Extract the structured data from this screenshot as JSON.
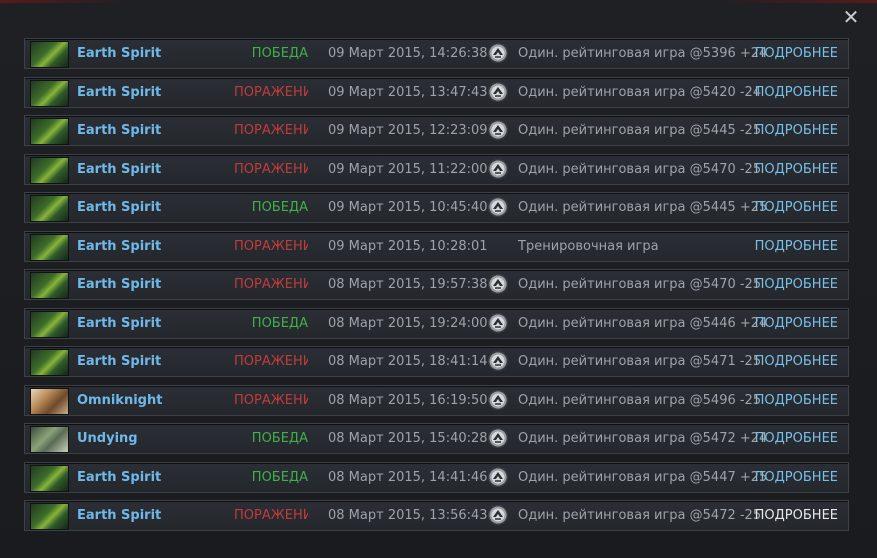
{
  "window": {
    "close_label": "✕"
  },
  "matches": [
    {
      "hero": "Earth Spirit",
      "hero_icon": "earth-spirit",
      "result": "ПОБЕДА",
      "outcome": "win",
      "date": "09 Март 2015, 14:26:38",
      "mode": "Один. рейтинговая игра @5396 +24",
      "mode_icon": "ranked-icon",
      "details": "ПОДРОБНЕЕ"
    },
    {
      "hero": "Earth Spirit",
      "hero_icon": "earth-spirit",
      "result": "ПОРАЖЕНИ",
      "outcome": "loss",
      "date": "09 Март 2015, 13:47:43",
      "mode": "Один. рейтинговая игра @5420 -24",
      "mode_icon": "ranked-icon",
      "details": "ПОДРОБНЕЕ"
    },
    {
      "hero": "Earth Spirit",
      "hero_icon": "earth-spirit",
      "result": "ПОРАЖЕНИ",
      "outcome": "loss",
      "date": "09 Март 2015, 12:23:09",
      "mode": "Один. рейтинговая игра @5445 -25",
      "mode_icon": "ranked-icon",
      "details": "ПОДРОБНЕЕ"
    },
    {
      "hero": "Earth Spirit",
      "hero_icon": "earth-spirit",
      "result": "ПОРАЖЕНИ",
      "outcome": "loss",
      "date": "09 Март 2015, 11:22:00",
      "mode": "Один. рейтинговая игра @5470 -25",
      "mode_icon": "ranked-icon",
      "details": "ПОДРОБНЕЕ"
    },
    {
      "hero": "Earth Spirit",
      "hero_icon": "earth-spirit",
      "result": "ПОБЕДА",
      "outcome": "win",
      "date": "09 Март 2015, 10:45:40",
      "mode": "Один. рейтинговая игра @5445 +25",
      "mode_icon": "ranked-icon",
      "details": "ПОДРОБНЕЕ"
    },
    {
      "hero": "Earth Spirit",
      "hero_icon": "earth-spirit",
      "result": "ПОРАЖЕНИ",
      "outcome": "loss",
      "date": "09 Март 2015, 10:28:01",
      "mode": "Тренировочная игра",
      "mode_icon": "",
      "details": "ПОДРОБНЕЕ"
    },
    {
      "hero": "Earth Spirit",
      "hero_icon": "earth-spirit",
      "result": "ПОРАЖЕНИ",
      "outcome": "loss",
      "date": "08 Март 2015, 19:57:38",
      "mode": "Один. рейтинговая игра @5470 -25",
      "mode_icon": "ranked-icon",
      "details": "ПОДРОБНЕЕ"
    },
    {
      "hero": "Earth Spirit",
      "hero_icon": "earth-spirit",
      "result": "ПОБЕДА",
      "outcome": "win",
      "date": "08 Март 2015, 19:24:00",
      "mode": "Один. рейтинговая игра @5446 +24",
      "mode_icon": "ranked-icon",
      "details": "ПОДРОБНЕЕ"
    },
    {
      "hero": "Earth Spirit",
      "hero_icon": "earth-spirit",
      "result": "ПОРАЖЕНИ",
      "outcome": "loss",
      "date": "08 Март 2015, 18:41:14",
      "mode": "Один. рейтинговая игра @5471 -25",
      "mode_icon": "ranked-icon",
      "details": "ПОДРОБНЕЕ"
    },
    {
      "hero": "Omniknight",
      "hero_icon": "omniknight",
      "result": "ПОРАЖЕНИ",
      "outcome": "loss",
      "date": "08 Март 2015, 16:19:50",
      "mode": "Один. рейтинговая игра @5496 -25",
      "mode_icon": "ranked-icon",
      "details": "ПОДРОБНЕЕ"
    },
    {
      "hero": "Undying",
      "hero_icon": "undying",
      "result": "ПОБЕДА",
      "outcome": "win",
      "date": "08 Март 2015, 15:40:28",
      "mode": "Один. рейтинговая игра @5472 +24",
      "mode_icon": "ranked-icon",
      "details": "ПОДРОБНЕЕ"
    },
    {
      "hero": "Earth Spirit",
      "hero_icon": "earth-spirit",
      "result": "ПОБЕДА",
      "outcome": "win",
      "date": "08 Март 2015, 14:41:46",
      "mode": "Один. рейтинговая игра @5447 +25",
      "mode_icon": "ranked-icon",
      "details": "ПОДРОБНЕЕ"
    },
    {
      "hero": "Earth Spirit",
      "hero_icon": "earth-spirit",
      "result": "ПОРАЖЕНИ",
      "outcome": "loss",
      "date": "08 Март 2015, 13:56:43",
      "mode": "Один. рейтинговая игра @5472 -25",
      "mode_icon": "ranked-icon",
      "details": "ПОДРОБНЕЕ"
    }
  ],
  "colors": {
    "win": "#3fb04a",
    "loss": "#c23b3b",
    "hero_name": "#6fb9ea",
    "details_link": "#78bfe8",
    "details_link_active": "#e6e8ea"
  }
}
